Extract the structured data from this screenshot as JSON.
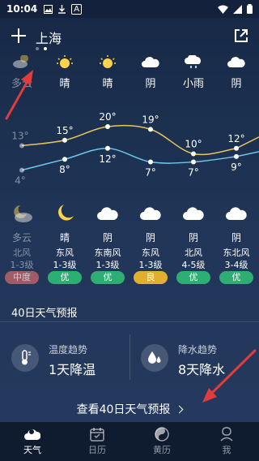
{
  "status_bar": {
    "time": "10:04",
    "indicator": "A"
  },
  "header": {
    "city": "上海"
  },
  "forecast": [
    {
      "day_weather": "多云",
      "night_weather": "多云",
      "wind_dir": "北风",
      "wind_level": "1-3级",
      "aqi": "中度",
      "aqi_color": "#c86a6a",
      "high": 13,
      "low": 4,
      "past": true
    },
    {
      "day_weather": "晴",
      "night_weather": "晴",
      "wind_dir": "东风",
      "wind_level": "1-3级",
      "aqi": "优",
      "aqi_color": "#2fae74",
      "high": 15,
      "low": 8
    },
    {
      "day_weather": "晴",
      "night_weather": "阴",
      "wind_dir": "东南风",
      "wind_level": "1-3级",
      "aqi": "优",
      "aqi_color": "#2fae74",
      "high": 20,
      "low": 12
    },
    {
      "day_weather": "阴",
      "night_weather": "阴",
      "wind_dir": "东风",
      "wind_level": "1-3级",
      "aqi": "良",
      "aqi_color": "#e0b02c",
      "high": 19,
      "low": 7
    },
    {
      "day_weather": "小雨",
      "night_weather": "阴",
      "wind_dir": "北风",
      "wind_level": "4-5级",
      "aqi": "优",
      "aqi_color": "#2fae74",
      "high": 10,
      "low": 7
    },
    {
      "day_weather": "阴",
      "night_weather": "阴",
      "wind_dir": "东北风",
      "wind_level": "3-4级",
      "aqi": "优",
      "aqi_color": "#2fae74",
      "high": 12,
      "low": 9
    }
  ],
  "chart_data": {
    "type": "line",
    "x": [
      "0",
      "1",
      "2",
      "3",
      "4",
      "5"
    ],
    "series": [
      {
        "values": [
          13,
          15,
          20,
          19,
          10,
          12
        ],
        "color": "#e6c55a"
      },
      {
        "values": [
          4,
          8,
          12,
          7,
          7,
          9
        ],
        "color": "#6cc7e8"
      }
    ],
    "y_unit": "°"
  },
  "section": {
    "title": "40日天气预报"
  },
  "trends": {
    "temp": {
      "label": "温度趋势",
      "value": "1天降温"
    },
    "rain": {
      "label": "降水趋势",
      "value": "8天降水"
    }
  },
  "view_more": "查看40日天气预报",
  "nav": [
    {
      "label": "天气",
      "icon": "cloud-icon",
      "active": true
    },
    {
      "label": "日历",
      "icon": "calendar-icon",
      "active": false
    },
    {
      "label": "黄历",
      "icon": "yinyang-icon",
      "active": false
    },
    {
      "label": "我",
      "icon": "person-icon",
      "active": false
    }
  ],
  "colors": {
    "annotation_arrow": "#e23b3b",
    "accent": "#ffd34d"
  }
}
